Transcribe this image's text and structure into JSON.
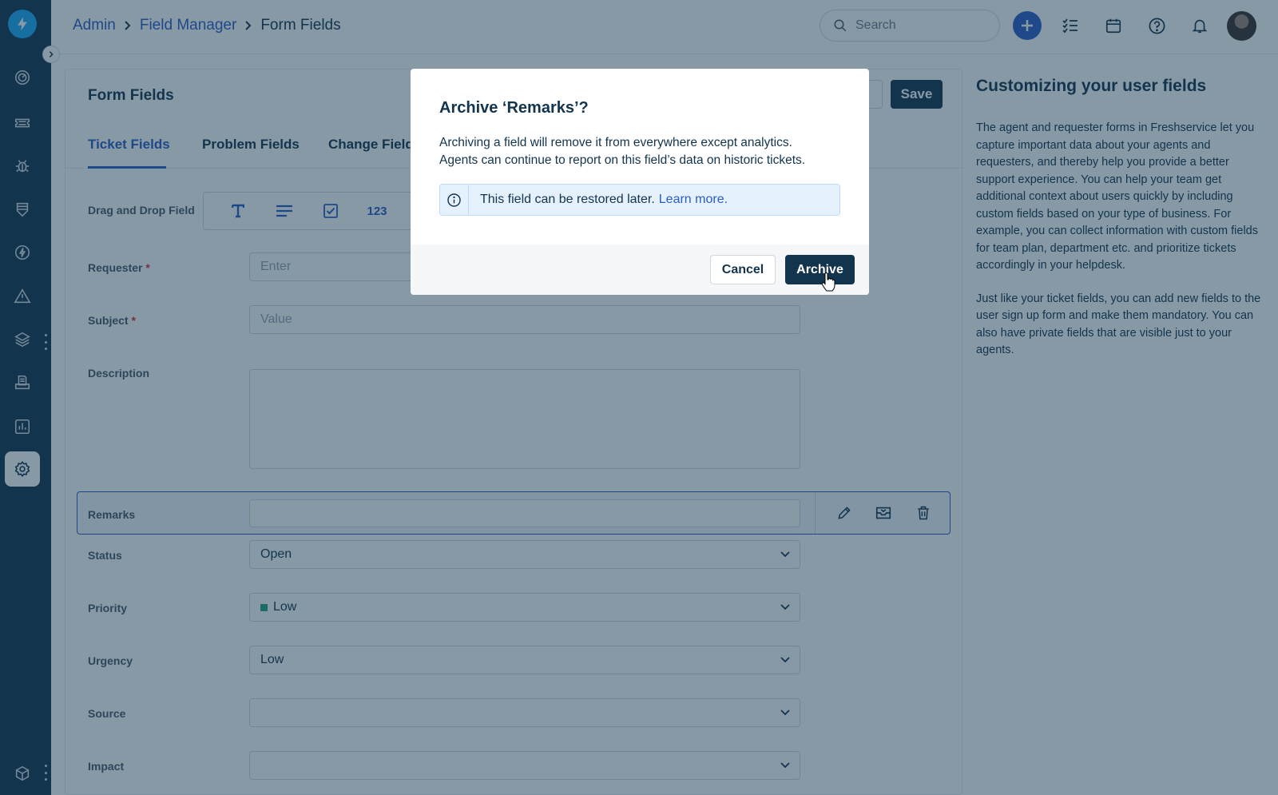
{
  "header": {
    "breadcrumb": {
      "admin": "Admin",
      "field_manager": "Field Manager",
      "current": "Form Fields"
    },
    "search_placeholder": "Search",
    "icons": [
      "plus-icon",
      "tasks-icon",
      "calendar-icon",
      "help-icon",
      "bell-icon"
    ]
  },
  "sidebar": {
    "items": [
      "dashboard-icon",
      "tickets-icon",
      "problems-icon",
      "changes-icon",
      "releases-icon",
      "alerts-icon",
      "assets-icon",
      "solutions-icon",
      "reports-icon",
      "admin-icon",
      "apps-icon"
    ],
    "active": "admin-icon"
  },
  "card": {
    "title": "Form Fields",
    "save_label": "Save",
    "tabs": [
      {
        "label": "Ticket Fields",
        "active": true
      },
      {
        "label": "Problem Fields",
        "active": false
      },
      {
        "label": "Change Fields",
        "active": false
      }
    ],
    "palette_label": "Drag and Drop Field",
    "palette_number": "123",
    "fields": {
      "requester": {
        "label": "Requester",
        "required": "*",
        "placeholder": "Enter"
      },
      "subject": {
        "label": "Subject",
        "required": "*",
        "placeholder": "Value"
      },
      "description": {
        "label": "Description"
      },
      "remarks": {
        "label": "Remarks"
      },
      "status": {
        "label": "Status",
        "value": "Open"
      },
      "priority": {
        "label": "Priority",
        "value": "Low",
        "color": "#24a382"
      },
      "urgency": {
        "label": "Urgency",
        "value": "Low"
      },
      "source": {
        "label": "Source",
        "value": ""
      },
      "impact": {
        "label": "Impact",
        "value": ""
      }
    }
  },
  "help": {
    "title": "Customizing your user fields",
    "para1": "The agent and requester forms in Freshservice let you capture important data about your agents and requesters, and thereby help you provide a better support experience. You can help your team get additional context about users quickly by including custom fields based on your type of business. For example, you can collect information with custom fields for team plan, department etc. and prioritize tickets accordingly in your helpdesk.",
    "para2": "Just like your ticket fields, you can add new fields to the user sign up form and make them mandatory. You can also have private fields that are visible just to your agents."
  },
  "modal": {
    "title": "Archive ‘Remarks’?",
    "body_line1": "Archiving a field will remove it from everywhere except analytics.",
    "body_line2": "Agents can continue to report on this field’s data on historic tickets.",
    "notice": "This field can be restored later.",
    "notice_link": "Learn more.",
    "cancel_label": "Cancel",
    "archive_label": "Archive"
  },
  "colors": {
    "primary": "#12344d",
    "link": "#2c5cc5",
    "logo": "#1ba9f5",
    "notice_bg": "#e5f2fd"
  }
}
